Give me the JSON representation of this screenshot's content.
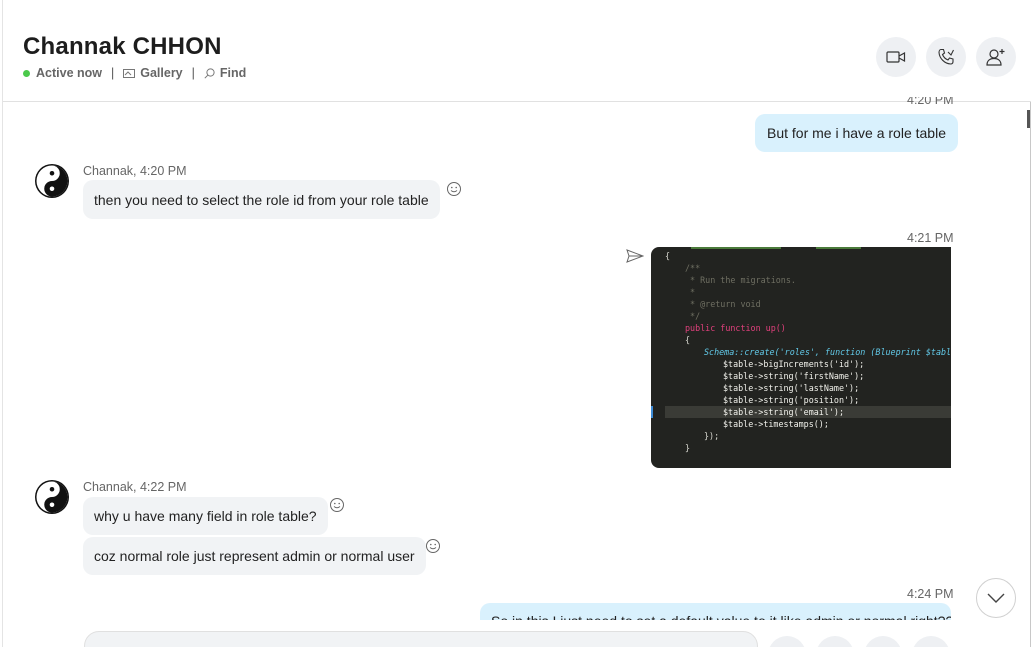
{
  "chat": {
    "contact_name": "Channak CHHON",
    "status": "Active now",
    "gallery_label": "Gallery",
    "find_label": "Find"
  },
  "header_actions": [
    {
      "name": "video-call",
      "icon": "video-camera-icon"
    },
    {
      "name": "audio-call",
      "icon": "phone-icon"
    },
    {
      "name": "add-people",
      "icon": "add-person-icon"
    }
  ],
  "messages": {
    "m1": {
      "direction": "outgoing",
      "time": "4:20 PM",
      "text": "But for me i have a role table"
    },
    "m2": {
      "direction": "incoming",
      "sender_time": "Channak, 4:20 PM",
      "text": "then you need to select the role id from your role table"
    },
    "m3": {
      "direction": "outgoing",
      "time": "4:21 PM",
      "type": "image",
      "code_lines": [
        "{",
        "/**",
        " * Run the migrations.",
        " *",
        " * @return void",
        " */",
        "public function up()",
        "{",
        "Schema::create('roles', function (Blueprint $table)",
        "$table->bigIncrements('id');",
        "$table->string('firstName');",
        "$table->string('lastName');",
        "$table->string('position');",
        "$table->string('email');",
        "$table->timestamps();",
        "});",
        "}"
      ]
    },
    "m4": {
      "direction": "incoming",
      "sender_time": "Channak, 4:22 PM",
      "text": "why u have many field in role table?"
    },
    "m5": {
      "direction": "incoming",
      "text": "coz normal role just represent admin or normal user"
    },
    "m6": {
      "direction": "outgoing",
      "time": "4:24 PM",
      "text": "So in this I just need to set a default value to it like admin or normal right??"
    }
  },
  "colors": {
    "outgoing_bubble": "#d9f1fd",
    "incoming_bubble": "#f1f3f5",
    "status_dot": "#4bc94b",
    "code_bg": "#222320"
  }
}
